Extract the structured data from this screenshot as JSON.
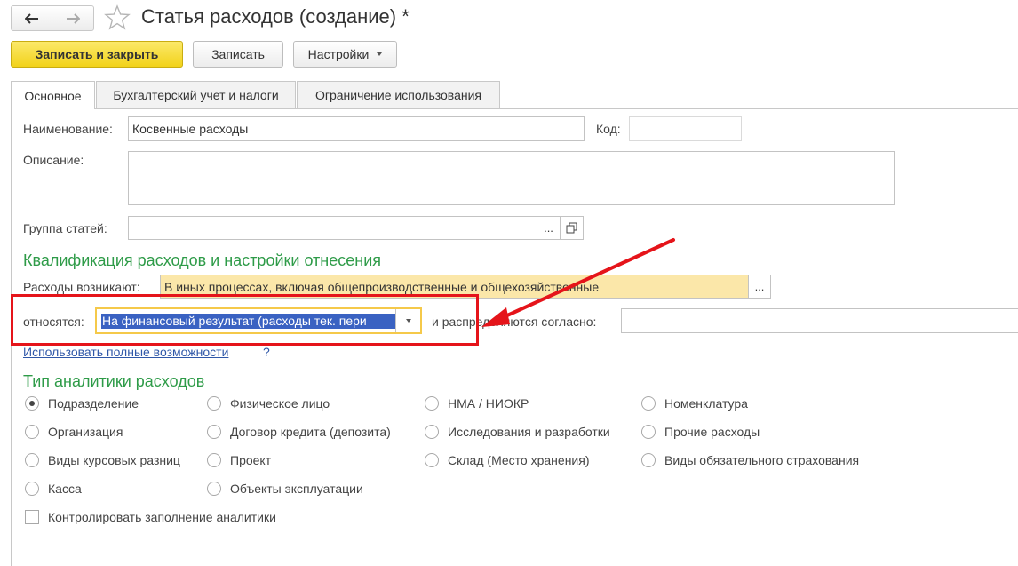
{
  "window": {
    "title": "Статья расходов (создание) *"
  },
  "toolbar": {
    "save_close": "Записать и закрыть",
    "save": "Записать",
    "settings": "Настройки"
  },
  "tabs": [
    {
      "label": "Основное",
      "active": true
    },
    {
      "label": "Бухгалтерский учет и налоги",
      "active": false
    },
    {
      "label": "Ограничение использования",
      "active": false
    }
  ],
  "form": {
    "name_label": "Наименование:",
    "name_value": "Косвенные расходы",
    "code_label": "Код:",
    "code_value": "",
    "description_label": "Описание:",
    "description_value": "",
    "group_label": "Группа статей:",
    "group_value": "",
    "group_select_btn": "...",
    "section_qualification": "Квалификация расходов и настройки отнесения",
    "arise_label": "Расходы возникают:",
    "arise_value": "В иных процессах, включая общепроизводственные и общехозяйственные",
    "arise_btn": "...",
    "relate_label": "относятся:",
    "relate_value": "На финансовый результат (расходы тек. пери",
    "distribute_label": "и распределяются согласно:",
    "distribute_value": "",
    "full_features_link": "Использовать полные возможности",
    "help_mark": "?",
    "section_analytics": "Тип аналитики расходов",
    "analytics_options": [
      {
        "label": "Подразделение",
        "selected": true
      },
      {
        "label": "Организация",
        "selected": false
      },
      {
        "label": "Виды курсовых разниц",
        "selected": false
      },
      {
        "label": "Касса",
        "selected": false
      },
      {
        "label": "Физическое лицо",
        "selected": false
      },
      {
        "label": "Договор кредита (депозита)",
        "selected": false
      },
      {
        "label": "Проект",
        "selected": false
      },
      {
        "label": "Объекты эксплуатации",
        "selected": false
      },
      {
        "label": "НМА / НИОКР",
        "selected": false
      },
      {
        "label": "Исследования и разработки",
        "selected": false
      },
      {
        "label": "Склад (Место хранения)",
        "selected": false
      },
      {
        "label": "Номенклатура",
        "selected": false
      },
      {
        "label": "Прочие расходы",
        "selected": false
      },
      {
        "label": "Виды обязательного страхования",
        "selected": false
      }
    ],
    "control_checkbox_label": "Контролировать заполнение аналитики",
    "control_checkbox_checked": false
  },
  "colors": {
    "primary_button": "#f2d21a",
    "section_heading": "#2e9b48",
    "highlight": "#e5141a",
    "selection": "#3a62c2"
  },
  "icons": [
    "back-arrow-icon",
    "forward-arrow-icon",
    "favorite-star-icon",
    "open-in-window-icon",
    "dropdown-caret-icon"
  ]
}
